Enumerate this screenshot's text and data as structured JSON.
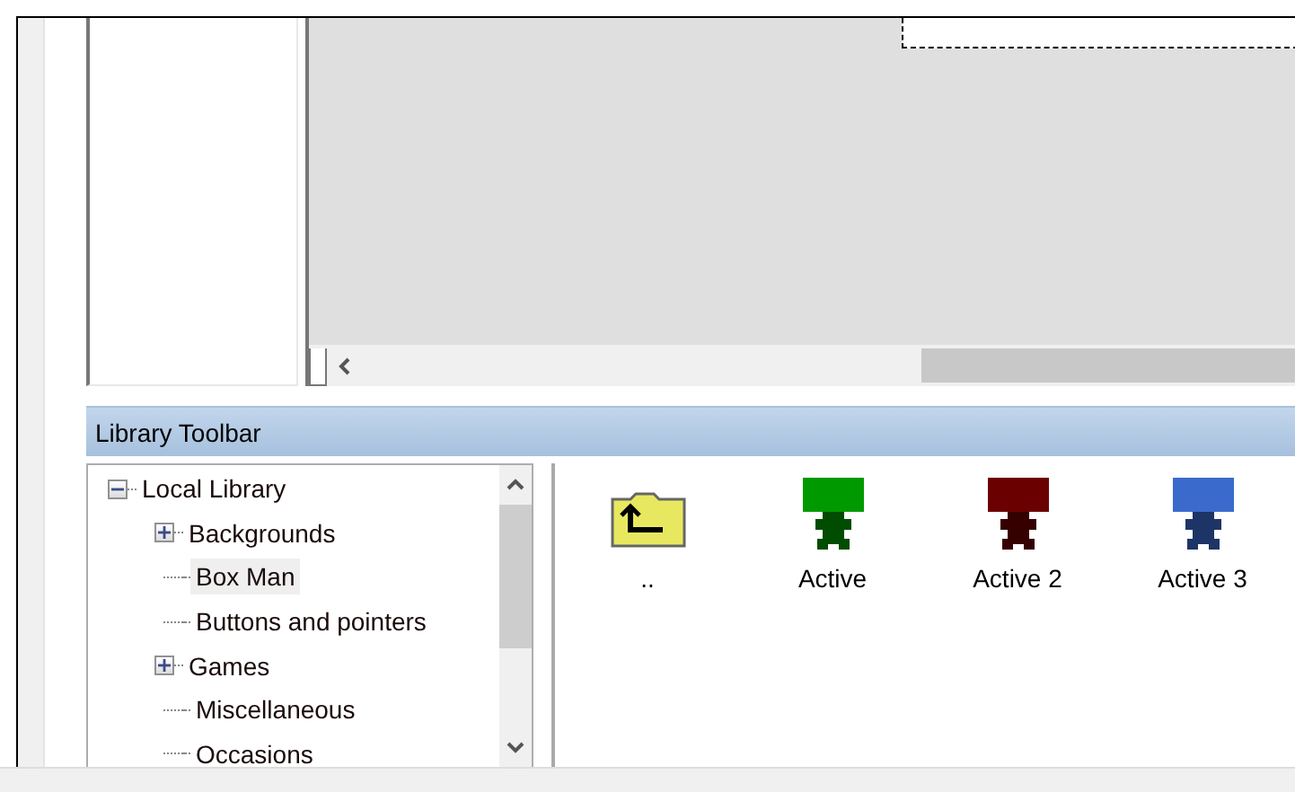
{
  "toolbar": {
    "title": "Library Toolbar"
  },
  "tree": {
    "label": "Local Library",
    "expanded": true,
    "selected": false,
    "children": [
      {
        "label": "Backgrounds",
        "expanded": false,
        "selected": false
      },
      {
        "label": "Box Man",
        "selected": true
      },
      {
        "label": "Buttons and pointers",
        "selected": false
      },
      {
        "label": "Games",
        "expanded": false,
        "selected": false
      },
      {
        "label": "Miscellaneous",
        "selected": false
      },
      {
        "label": "Occasions",
        "selected": false
      }
    ]
  },
  "items": [
    {
      "kind": "folder-up",
      "label": ".."
    },
    {
      "kind": "figure",
      "label": "Active",
      "color": "#009900"
    },
    {
      "kind": "figure",
      "label": "Active 2",
      "color": "#6b0000"
    },
    {
      "kind": "figure",
      "label": "Active 3",
      "color": "#3a6acc"
    }
  ]
}
